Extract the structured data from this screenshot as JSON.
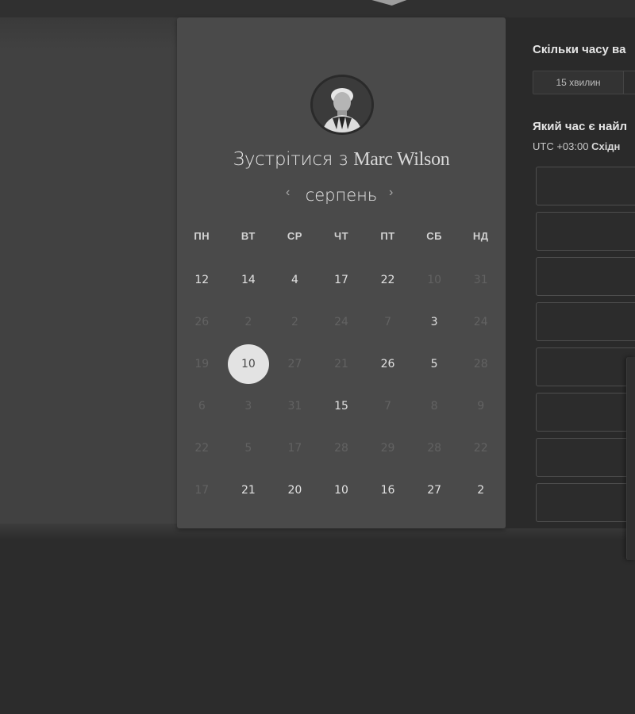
{
  "booking": {
    "title_prefix": "Зустрітися з",
    "host_name": "Marc Wilson",
    "month": "серпень",
    "prev_icon": "‹",
    "next_icon": "›"
  },
  "weekdays": [
    "ПН",
    "ВТ",
    "СР",
    "ЧТ",
    "ПТ",
    "СБ",
    "НД"
  ],
  "calendar": {
    "rows": [
      [
        {
          "d": "12",
          "a": true
        },
        {
          "d": "14",
          "a": true
        },
        {
          "d": "4",
          "a": true
        },
        {
          "d": "17",
          "a": true
        },
        {
          "d": "22",
          "a": true
        },
        {
          "d": "10",
          "a": false
        },
        {
          "d": "31",
          "a": false
        }
      ],
      [
        {
          "d": "26",
          "a": false
        },
        {
          "d": "2",
          "a": false
        },
        {
          "d": "2",
          "a": false
        },
        {
          "d": "24",
          "a": false
        },
        {
          "d": "7",
          "a": false
        },
        {
          "d": "3",
          "a": true
        },
        {
          "d": "24",
          "a": false
        }
      ],
      [
        {
          "d": "19",
          "a": false
        },
        {
          "d": "10",
          "a": true,
          "sel": true
        },
        {
          "d": "27",
          "a": false
        },
        {
          "d": "21",
          "a": false
        },
        {
          "d": "26",
          "a": true
        },
        {
          "d": "5",
          "a": true
        },
        {
          "d": "28",
          "a": false
        }
      ],
      [
        {
          "d": "6",
          "a": false
        },
        {
          "d": "3",
          "a": false
        },
        {
          "d": "31",
          "a": false
        },
        {
          "d": "15",
          "a": true
        },
        {
          "d": "7",
          "a": false
        },
        {
          "d": "8",
          "a": false
        },
        {
          "d": "9",
          "a": false
        }
      ],
      [
        {
          "d": "22",
          "a": false
        },
        {
          "d": "5",
          "a": false
        },
        {
          "d": "17",
          "a": false
        },
        {
          "d": "28",
          "a": false
        },
        {
          "d": "29",
          "a": false
        },
        {
          "d": "28",
          "a": false
        },
        {
          "d": "22",
          "a": false
        }
      ],
      [
        {
          "d": "17",
          "a": false
        },
        {
          "d": "21",
          "a": true
        },
        {
          "d": "20",
          "a": true
        },
        {
          "d": "10",
          "a": true
        },
        {
          "d": "16",
          "a": true
        },
        {
          "d": "27",
          "a": true
        },
        {
          "d": "2",
          "a": true
        }
      ]
    ]
  },
  "right": {
    "duration_question": "Скільки часу ва",
    "duration_option": "15 хвилин",
    "time_question": "Який час є найл",
    "tz_offset": "UTC +03:00",
    "tz_name": "Східн"
  }
}
